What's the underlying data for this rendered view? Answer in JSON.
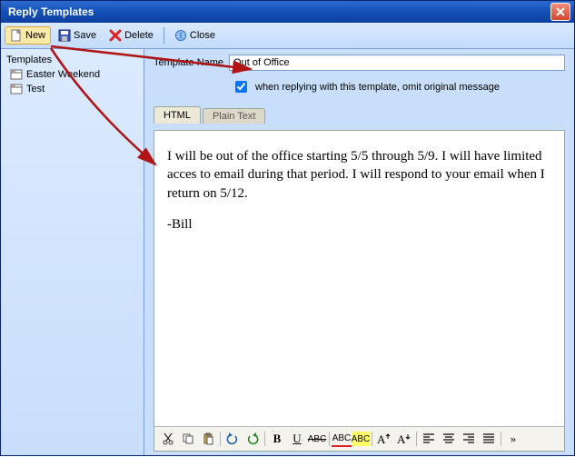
{
  "window": {
    "title": "Reply Templates"
  },
  "toolbar": {
    "new_label": "New",
    "save_label": "Save",
    "delete_label": "Delete",
    "close_label": "Close"
  },
  "sidebar": {
    "header": "Templates",
    "items": [
      {
        "label": "Easter Weekend"
      },
      {
        "label": "Test"
      }
    ]
  },
  "form": {
    "name_label": "Template Name",
    "name_value": "Out of Office",
    "omit_label": "when replying with this template, omit original message",
    "omit_checked": true
  },
  "tabs": {
    "html": "HTML",
    "plain": "Plain Text"
  },
  "editor": {
    "body1": "I will be out of the office starting 5/5 through 5/9. I will have limited acces to email during that period. I will respond to your email when I return on 5/12.",
    "signature": "-Bill"
  },
  "editor_toolbar": {
    "bold": "B",
    "underline": "U",
    "strike_label": "ABC",
    "fontcolor_label": "ABC",
    "bgcolor_label": "ABC",
    "more": "»"
  }
}
